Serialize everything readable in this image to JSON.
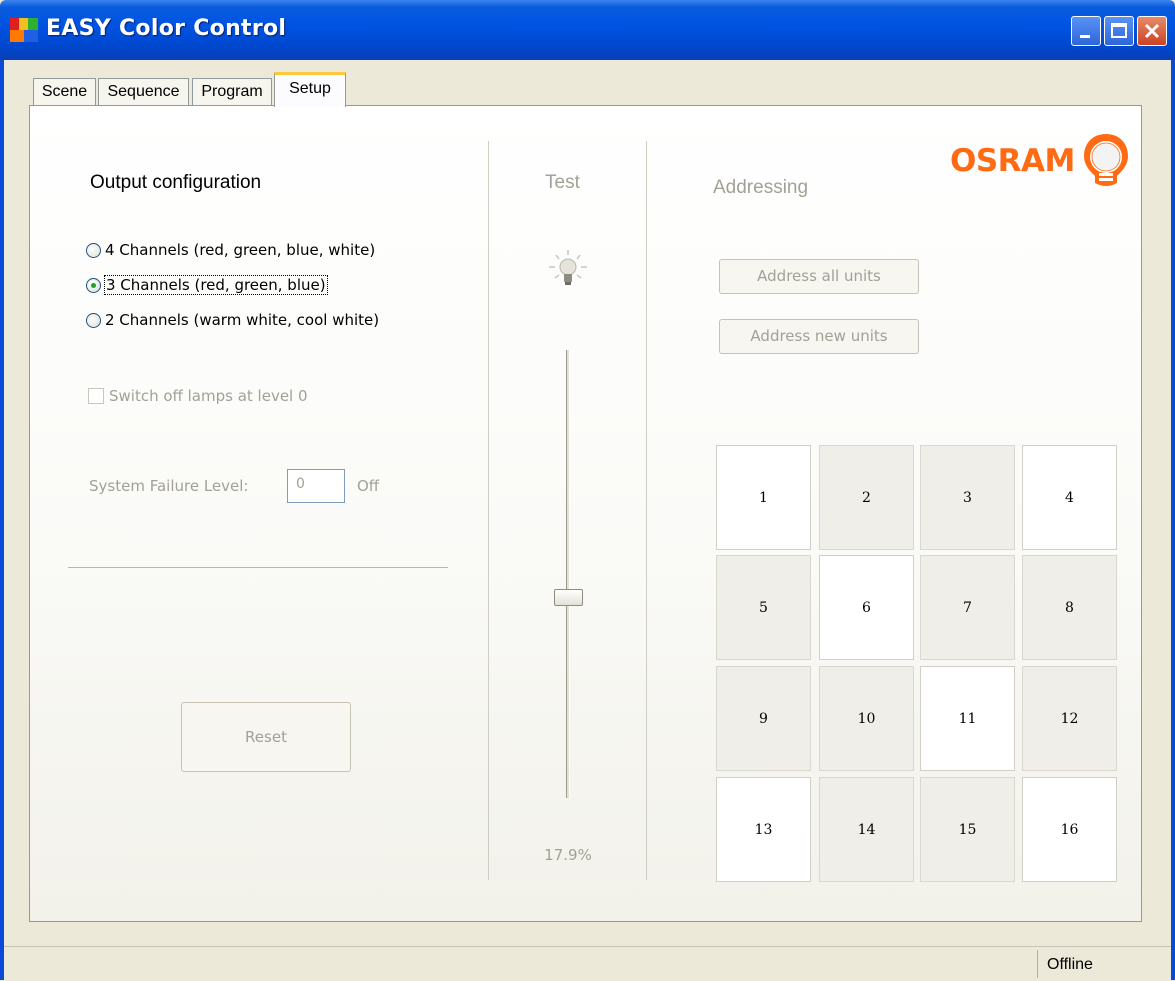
{
  "window": {
    "title": "EASY Color Control"
  },
  "tabs": [
    {
      "label": "Scene"
    },
    {
      "label": "Sequence"
    },
    {
      "label": "Program"
    },
    {
      "label": "Setup",
      "active": true
    }
  ],
  "output_config": {
    "title": "Output configuration",
    "options": [
      {
        "label": "4 Channels (red, green, blue, white)",
        "checked": false
      },
      {
        "label": "3 Channels (red, green, blue)",
        "checked": true
      },
      {
        "label": "2 Channels (warm white, cool white)",
        "checked": false
      }
    ],
    "switch_off_label": "Switch off lamps at level 0",
    "switch_off_checked": false,
    "system_failure_label": "System Failure Level:",
    "system_failure_value": "0",
    "system_failure_unit": "Off",
    "reset_label": "Reset"
  },
  "test": {
    "title": "Test",
    "icon": "light-bulb-icon",
    "level_percent": 17.9,
    "level_label": "17.9%"
  },
  "addressing": {
    "title": "Addressing",
    "address_all_label": "Address all units",
    "address_new_label": "Address new units",
    "units": [
      {
        "number": "1",
        "active": true
      },
      {
        "number": "2",
        "active": false
      },
      {
        "number": "3",
        "active": false
      },
      {
        "number": "4",
        "active": true
      },
      {
        "number": "5",
        "active": false
      },
      {
        "number": "6",
        "active": true
      },
      {
        "number": "7",
        "active": false
      },
      {
        "number": "8",
        "active": false
      },
      {
        "number": "9",
        "active": false
      },
      {
        "number": "10",
        "active": false
      },
      {
        "number": "11",
        "active": true
      },
      {
        "number": "12",
        "active": false
      },
      {
        "number": "13",
        "active": true
      },
      {
        "number": "14",
        "active": false
      },
      {
        "number": "15",
        "active": false
      },
      {
        "number": "16",
        "active": true
      }
    ]
  },
  "brand": {
    "logo_text": "OSRAM",
    "logo_color": "#ff6a13"
  },
  "statusbar": {
    "status": "Offline"
  },
  "colors": {
    "titlebar": "#0054e3",
    "tab_highlight": "#ffc83c",
    "disabled_text": "#a3a196"
  }
}
